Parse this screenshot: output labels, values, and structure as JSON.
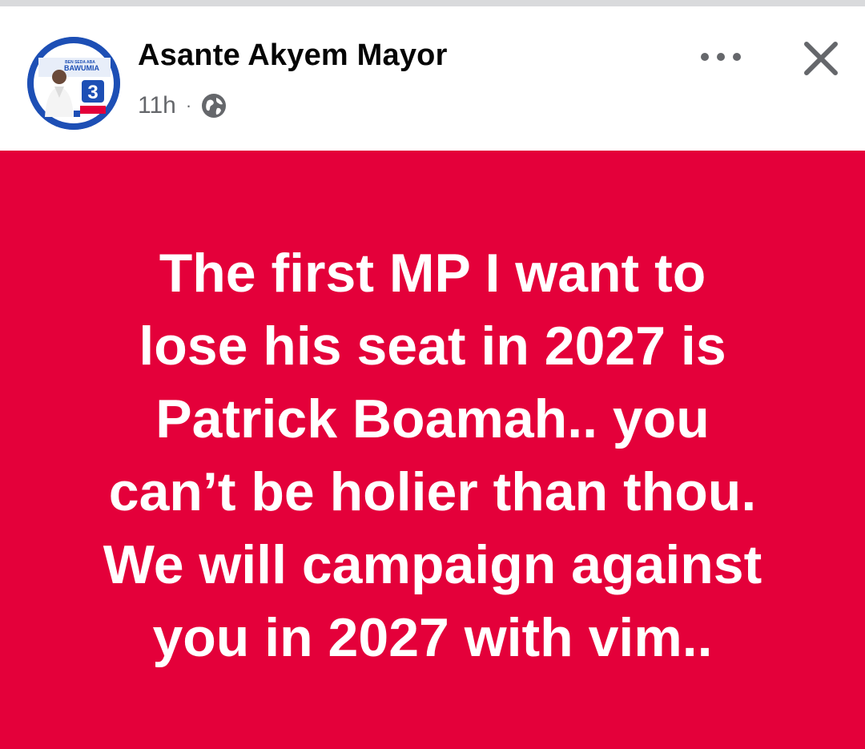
{
  "post": {
    "author": "Asante Akyem Mayor",
    "time": "11h",
    "separator": "·",
    "privacy_icon": "globe-icon",
    "avatar": {
      "banner_small": "BEN SEDA ABA",
      "banner_name": "BAWUMIA",
      "number": "3"
    },
    "more_icon": "more-horizontal-icon",
    "close_icon": "close-icon",
    "background_color": "#e4003a",
    "text_lines": [
      "The first MP I want to",
      "lose his seat in 2027 is",
      "Patrick Boamah.. you",
      "can’t be holier than thou.",
      "We will campaign against",
      "you in 2027 with vim.."
    ]
  }
}
